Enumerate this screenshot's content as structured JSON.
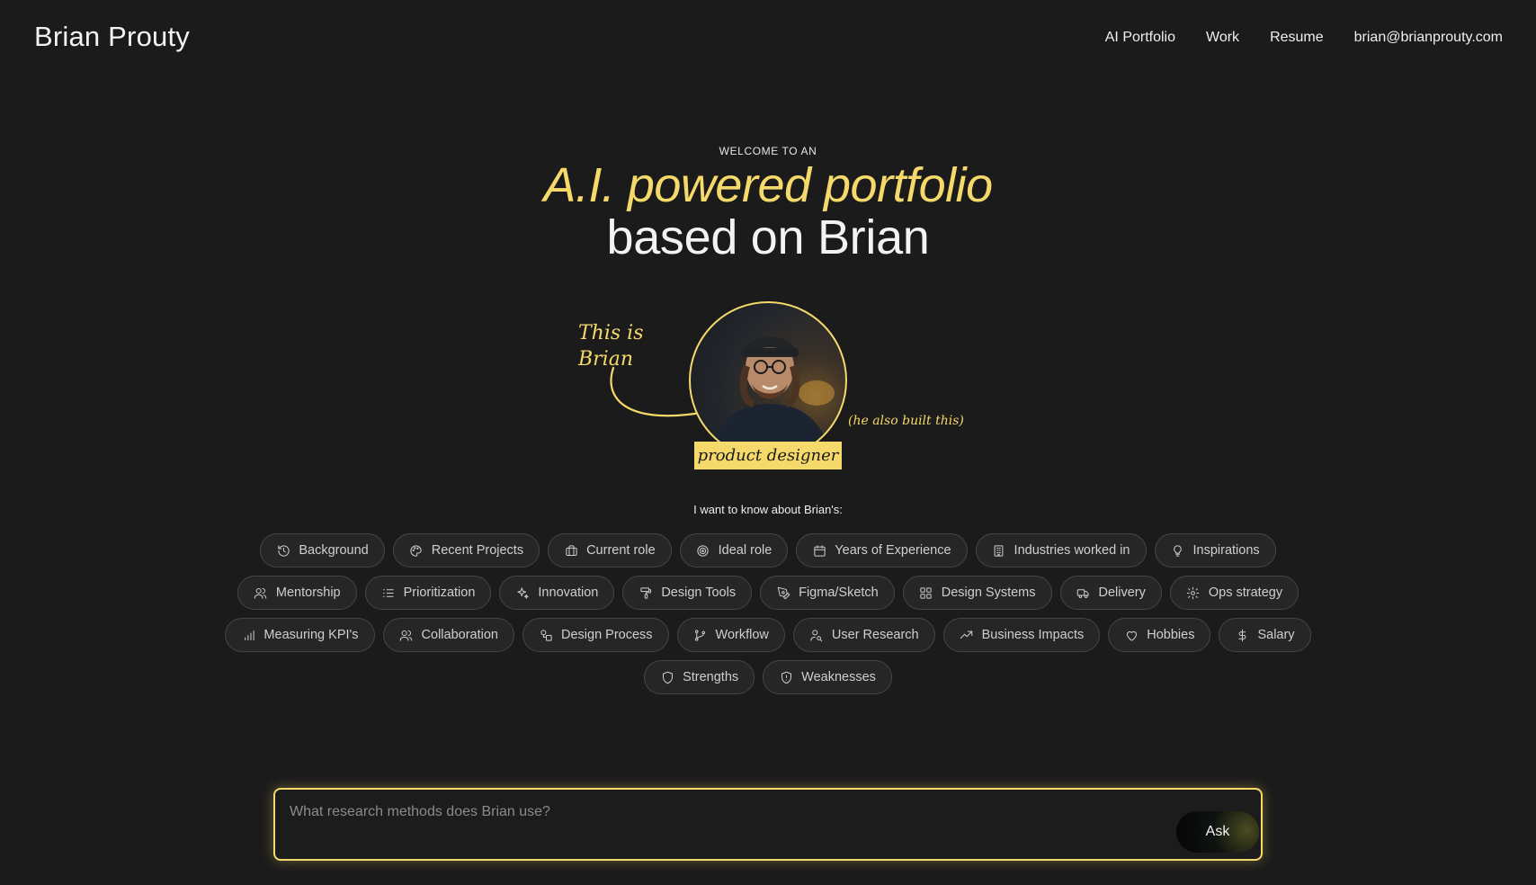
{
  "header": {
    "brand": "Brian Prouty",
    "nav": [
      "AI Portfolio",
      "Work",
      "Resume",
      "brian@brianprouty.com"
    ]
  },
  "hero": {
    "eyebrow": "WELCOME TO AN",
    "headline_highlight": "A.I. powered portfolio",
    "headline_rest": "based on Brian",
    "annotation_this_is_line1": "This is",
    "annotation_this_is_line2": "Brian",
    "annotation_built": "(he also built this)",
    "role_badge": "product designer"
  },
  "topics": {
    "prompt": "I want to know about Brian's:",
    "rows": [
      [
        {
          "label": "Background",
          "icon": "history-icon"
        },
        {
          "label": "Recent Projects",
          "icon": "palette-icon"
        },
        {
          "label": "Current role",
          "icon": "briefcase-icon"
        },
        {
          "label": "Ideal role",
          "icon": "target-icon"
        },
        {
          "label": "Years of Experience",
          "icon": "calendar-icon"
        },
        {
          "label": "Industries worked in",
          "icon": "building-icon"
        },
        {
          "label": "Inspirations",
          "icon": "lightbulb-icon"
        }
      ],
      [
        {
          "label": "Mentorship",
          "icon": "users-icon"
        },
        {
          "label": "Prioritization",
          "icon": "list-ordered-icon"
        },
        {
          "label": "Innovation",
          "icon": "sparkles-icon"
        },
        {
          "label": "Design Tools",
          "icon": "paint-roller-icon"
        },
        {
          "label": "Figma/Sketch",
          "icon": "pen-tool-icon"
        },
        {
          "label": "Design Systems",
          "icon": "grid-icon"
        },
        {
          "label": "Delivery",
          "icon": "truck-icon"
        },
        {
          "label": "Ops strategy",
          "icon": "gear-icon"
        }
      ],
      [
        {
          "label": "Measuring KPI's",
          "icon": "bar-chart-icon"
        },
        {
          "label": "Collaboration",
          "icon": "users-icon"
        },
        {
          "label": "Design Process",
          "icon": "shapes-icon"
        },
        {
          "label": "Workflow",
          "icon": "git-branch-icon"
        },
        {
          "label": "User Research",
          "icon": "user-search-icon"
        },
        {
          "label": "Business Impacts",
          "icon": "trending-up-icon"
        },
        {
          "label": "Hobbies",
          "icon": "heart-icon"
        },
        {
          "label": "Salary",
          "icon": "dollar-icon"
        }
      ],
      [
        {
          "label": "Strengths",
          "icon": "shield-icon"
        },
        {
          "label": "Weaknesses",
          "icon": "shield-alert-icon"
        }
      ]
    ]
  },
  "ask": {
    "placeholder": "What research methods does Brian use?",
    "value": "",
    "button_label": "Ask"
  },
  "colors": {
    "background": "#1b1b1b",
    "accent": "#f5d96a",
    "chip_bg": "#262626",
    "chip_border": "#454545"
  }
}
